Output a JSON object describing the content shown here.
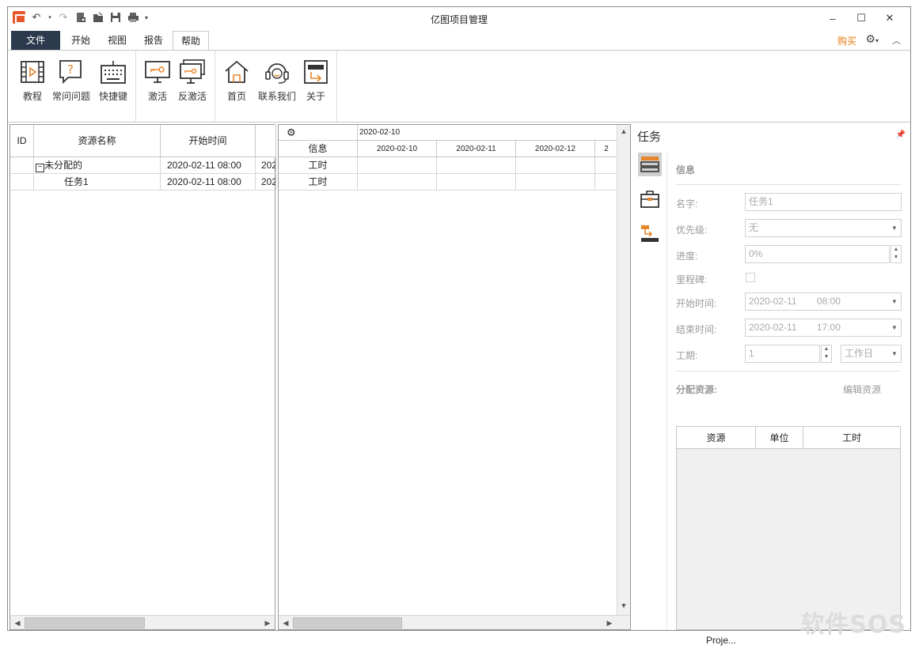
{
  "window": {
    "title": "亿图项目管理"
  },
  "tabs": [
    "文件",
    "开始",
    "视图",
    "报告",
    "帮助"
  ],
  "buy_label": "购买",
  "ribbon": {
    "groups": [
      {
        "buttons": [
          "教程",
          "常问问题",
          "快捷键"
        ]
      },
      {
        "buttons": [
          "激活",
          "反激活"
        ]
      },
      {
        "buttons": [
          "首页",
          "联系我们",
          "关于"
        ]
      }
    ]
  },
  "resource_grid": {
    "headers": [
      "ID",
      "资源名称",
      "开始时间",
      ""
    ],
    "rows": [
      {
        "id": "",
        "name": "未分配的",
        "expander": "−",
        "start": "2020-02-11 08:00",
        "extra": "202"
      },
      {
        "id": "",
        "name": "任务1",
        "expander": "",
        "start": "2020-02-11 08:00",
        "extra": "202"
      }
    ]
  },
  "timeline": {
    "top_date": "2020-02-10",
    "info_header": "信息",
    "dates": [
      "2020-02-10",
      "2020-02-11",
      "2020-02-12",
      "2"
    ],
    "rows": [
      "工时",
      "工时"
    ]
  },
  "task_panel": {
    "title": "任务",
    "section_info": "信息",
    "fields": {
      "name_label": "名字:",
      "name_value": "任务1",
      "priority_label": "优先级:",
      "priority_value": "无",
      "progress_label": "进度:",
      "progress_value": "0%",
      "milestone_label": "里程碑:",
      "start_label": "开始时间:",
      "start_date": "2020-02-11",
      "start_time": "08:00",
      "end_label": "结束时间:",
      "end_date": "2020-02-11",
      "end_time": "17:00",
      "duration_label": "工期:",
      "duration_value": "1",
      "duration_unit": "工作日"
    },
    "section_resources": "分配资源:",
    "edit_resources": "编辑资源",
    "resource_headers": [
      "资源",
      "单位",
      "工时"
    ]
  },
  "status_text": "Proje...",
  "watermark": "软件SOS"
}
